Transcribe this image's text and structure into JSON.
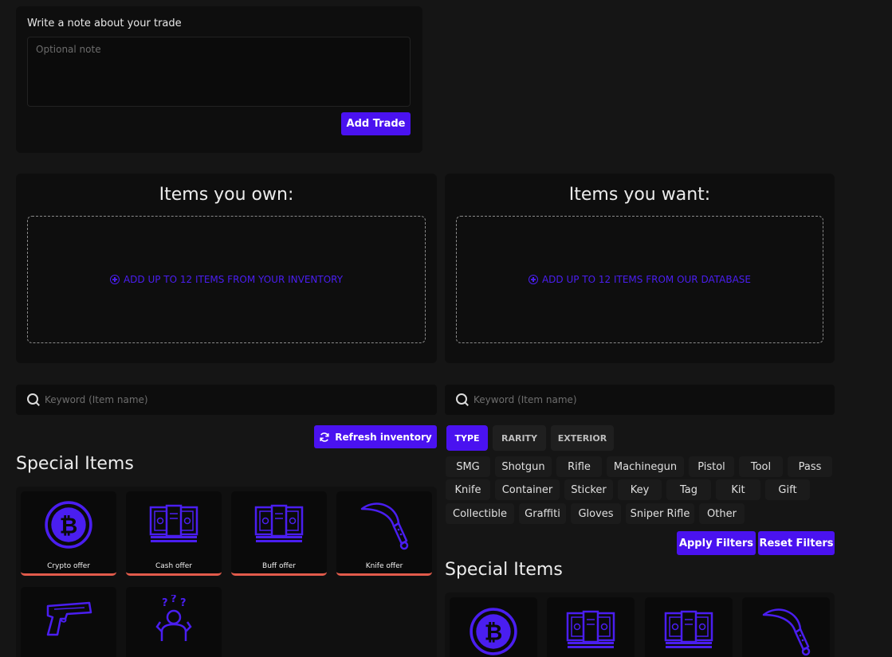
{
  "note": {
    "label": "Write a note about your trade",
    "placeholder": "Optional note",
    "value": "",
    "submit_label": "Add Trade"
  },
  "own": {
    "title": "Items you own:",
    "dropzone_text": "ADD UP TO 12 ITEMS FROM YOUR INVENTORY",
    "search_placeholder": "Keyword (Item name)",
    "refresh_label": "Refresh inventory",
    "special_title": "Special Items",
    "special_items": [
      {
        "label": "Crypto offer",
        "icon": "bitcoin-icon"
      },
      {
        "label": "Cash offer",
        "icon": "cash-icon"
      },
      {
        "label": "Buff offer",
        "icon": "cash-icon"
      },
      {
        "label": "Knife offer",
        "icon": "knife-icon"
      },
      {
        "label": "",
        "icon": "pistol-icon"
      },
      {
        "label": "",
        "icon": "confused-person-icon"
      }
    ]
  },
  "want": {
    "title": "Items you want:",
    "dropzone_text": "ADD UP TO 12 ITEMS FROM OUR DATABASE",
    "search_placeholder": "Keyword (Item name)",
    "filter_tabs": [
      "TYPE",
      "RARITY",
      "EXTERIOR"
    ],
    "active_tab": "TYPE",
    "type_chips": [
      "SMG",
      "Shotgun",
      "Rifle",
      "Machinegun",
      "Pistol",
      "Tool",
      "Pass",
      "Knife",
      "Container",
      "Sticker",
      "Key",
      "Tag",
      "Kit",
      "Gift",
      "Collectible",
      "Graffiti",
      "Gloves",
      "Sniper Rifle",
      "Other"
    ],
    "apply_label": "Apply Filters",
    "reset_label": "Reset Filters",
    "special_title": "Special Items",
    "special_items": [
      {
        "icon": "bitcoin-icon"
      },
      {
        "icon": "cash-icon"
      },
      {
        "icon": "cash-icon"
      },
      {
        "icon": "knife-icon"
      }
    ]
  },
  "colors": {
    "accent": "#4a12f0",
    "card_underline": "#e25b4b",
    "background": "#151515"
  }
}
